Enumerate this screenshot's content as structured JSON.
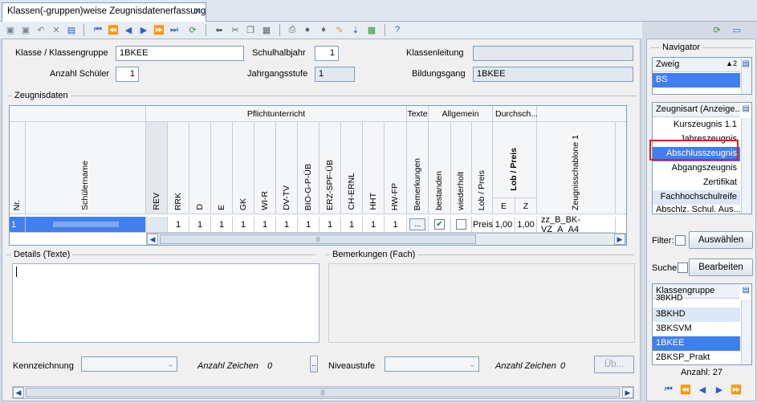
{
  "tab": {
    "title": "Klassen(-gruppen)weise Zeugnisdatenerfassung",
    "close": "✕"
  },
  "form": {
    "klasse_label": "Klasse / Klassengruppe",
    "klasse_value": "1BKEE",
    "anzahl_label": "Anzahl Schüler",
    "anzahl_value": "1",
    "halbjahr_label": "Schulhalbjahr",
    "halbjahr_value": "1",
    "jahrgang_label": "Jahrgangsstufe",
    "jahrgang_value": "1",
    "leitung_label": "Klassenleitung",
    "leitung_value": "",
    "bildungsgang_label": "Bildungsgang",
    "bildungsgang_value": "1BKEE"
  },
  "zeugnisdaten": {
    "title": "Zeugnisdaten",
    "groups": {
      "pflicht": "Pflichtunterricht",
      "texte": "Texte",
      "allgemein": "Allgemein",
      "durchschnitt": "Durchsch..."
    },
    "columns": [
      "Nr.",
      "Schülername",
      "REV",
      "RRK",
      "D",
      "E",
      "GK",
      "WI-R",
      "DV-TV",
      "BIO-G-P-ÜB",
      "ERZ-SPF-ÜB",
      "CH-ERNL",
      "HHT",
      "HW-FP",
      "Bemerkungen",
      "bestanden",
      "wiederholt",
      "Lob / Preis",
      "Lob / Preis",
      "Zeugnisschablone 1"
    ],
    "sub_e": "E",
    "sub_z": "Z",
    "row": {
      "nr": "1",
      "name": "",
      "rev": "",
      "grades": [
        "1",
        "1",
        "1",
        "1",
        "1",
        "1",
        "1",
        "1",
        "1",
        "1",
        "1"
      ],
      "bem": "...",
      "lob": "Preis",
      "e": "1,00",
      "z": "1,00",
      "schablone": "zz_B_BK-VZ_A_A4"
    }
  },
  "details": {
    "title": "Details (Texte)",
    "bem_title": "Bemerkungen (Fach)",
    "kenn_label": "Kennzeichnung",
    "anz_label": "Anzahl Zeichen",
    "anz_value": "0",
    "dots": "..",
    "niveau_label": "Niveaustufe",
    "anz2_label": "Anzahl Zeichen",
    "anz2_value": "0",
    "ueb_btn": "Üb..."
  },
  "navigator": {
    "title": "Navigator",
    "zweig_header": "Zweig",
    "zweig_sort": "▲2",
    "zweig_items": [
      "BS"
    ],
    "zeugnisart_header": "Zeugnisart (Anzeige...",
    "zeugnisart_items": [
      "Kurszeugnis 1.1",
      "Jahreszeugnis",
      "Abschlusszeugnis",
      "Abgangszeugnis",
      "Zertifikat",
      "Fachhochschulreife",
      "Abschlz. Schul. Aus..."
    ],
    "filter_label": "Filter:",
    "auswaehlen": "Auswählen",
    "suche_label": "Suche:",
    "bearbeiten": "Bearbeiten",
    "klassen_header": "Klassengruppe",
    "klassen_items": [
      "3BKHD",
      "3BKHD",
      "3BKSVM",
      "1BKEE",
      "2BKSP_Prakt"
    ],
    "anzahl": "Anzahl: 27"
  },
  "colors": {
    "accent": "#3f7ff0",
    "highlight_border": "#e02020"
  }
}
